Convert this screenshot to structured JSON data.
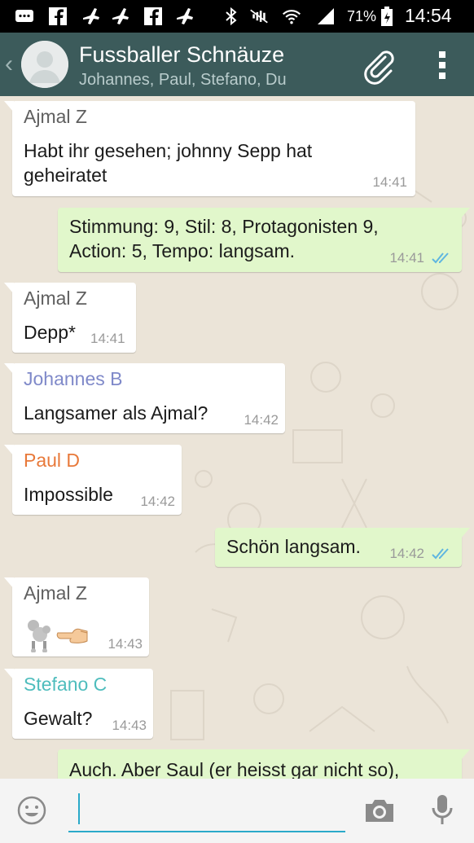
{
  "status_bar": {
    "battery": "71%",
    "time": "14:54"
  },
  "header": {
    "title": "Fussballer Schnäuze",
    "subtitle": "Johannes, Paul, Stefano, Du"
  },
  "colors": {
    "header_bg": "#3c5b5b",
    "outgoing_bubble": "#e1f7cb",
    "incoming_bubble": "#ffffff",
    "sender_ajmal": "#5f5f5f",
    "sender_johannes": "#7f89c9",
    "sender_paul": "#e8793a",
    "sender_stefano": "#4fbdbd",
    "read_ticks": "#5fb6e0"
  },
  "messages": [
    {
      "direction": "in",
      "sender": "Ajmal Z",
      "text_lines": [
        "Habt ihr gesehen; johnny Sepp hat",
        "geheiratet"
      ],
      "time": "14:41"
    },
    {
      "direction": "out",
      "text_lines": [
        "Stimmung: 9, Stil: 8, Protagonisten 9,",
        "Action: 5, Tempo: langsam."
      ],
      "time": "14:41",
      "status": "read"
    },
    {
      "direction": "in",
      "sender": "Ajmal Z",
      "text_lines": [
        "Depp*"
      ],
      "time": "14:41"
    },
    {
      "direction": "in",
      "sender": "Johannes B",
      "text_lines": [
        "Langsamer als Ajmal?"
      ],
      "time": "14:42"
    },
    {
      "direction": "in",
      "sender": "Paul D",
      "text_lines": [
        "Impossible"
      ],
      "time": "14:42"
    },
    {
      "direction": "out",
      "text_lines": [
        "Schön langsam."
      ],
      "time": "14:42",
      "status": "read"
    },
    {
      "direction": "in",
      "sender": "Ajmal Z",
      "emoji": [
        "poodle",
        "pointing-left-hand"
      ],
      "time": "14:43"
    },
    {
      "direction": "in",
      "sender": "Stefano C",
      "text_lines": [
        "Gewalt?"
      ],
      "time": "14:43"
    },
    {
      "direction": "out",
      "text_lines": [
        "Auch. Aber Saul (er heisst gar nicht so),"
      ],
      "time": ""
    }
  ],
  "icons": {
    "status_left": [
      "messages-icon",
      "facebook-icon",
      "flight-icon",
      "flight-icon",
      "facebook-icon",
      "flight-icon"
    ],
    "status_right": [
      "bluetooth-icon",
      "mute-icon",
      "wifi-icon",
      "signal-icon",
      "battery-icon"
    ],
    "header": [
      "back-chevron-icon",
      "group-avatar",
      "paperclip-icon",
      "overflow-menu-icon"
    ],
    "input": [
      "emoji-icon",
      "camera-icon",
      "microphone-icon"
    ]
  }
}
